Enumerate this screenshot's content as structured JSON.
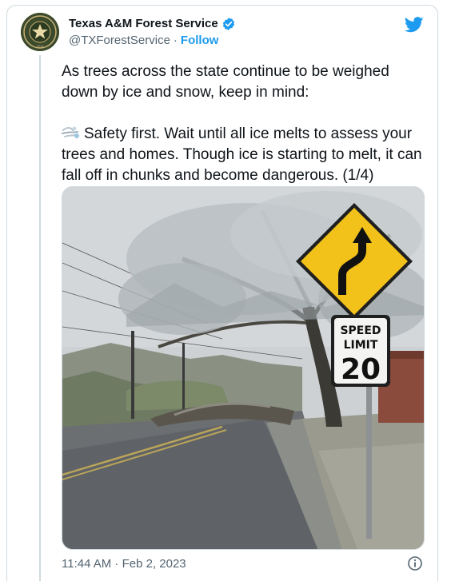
{
  "account": {
    "name": "Texas A&M Forest Service",
    "handle": "@TXForestService",
    "separator": "·",
    "follow_label": "Follow",
    "verified_icon": "verified-badge-icon",
    "avatar_icon": "texas-am-forest-service-seal",
    "seal_year": "1915"
  },
  "platform_icon": "twitter-bird-icon",
  "tweet": {
    "line1": "As trees across the state continue to be weighed down by ice and snow, keep in mind:",
    "emoji_icon": "dashing-wind-emoji",
    "line2": "Safety first. Wait until all ice melts to assess your trees and homes. Though ice is starting to melt, it can fall off in chunks and become dangerous. (1/4)"
  },
  "photo": {
    "sign_top": "SPEED",
    "sign_middle": "LIMIT",
    "sign_number": "20"
  },
  "footer": {
    "timestamp": "11:44 AM · Feb 2, 2023",
    "info_icon": "info-icon"
  },
  "colors": {
    "accent": "#1d9bf0",
    "text": "#0f1419",
    "muted": "#536471",
    "border": "#cfd9de"
  }
}
